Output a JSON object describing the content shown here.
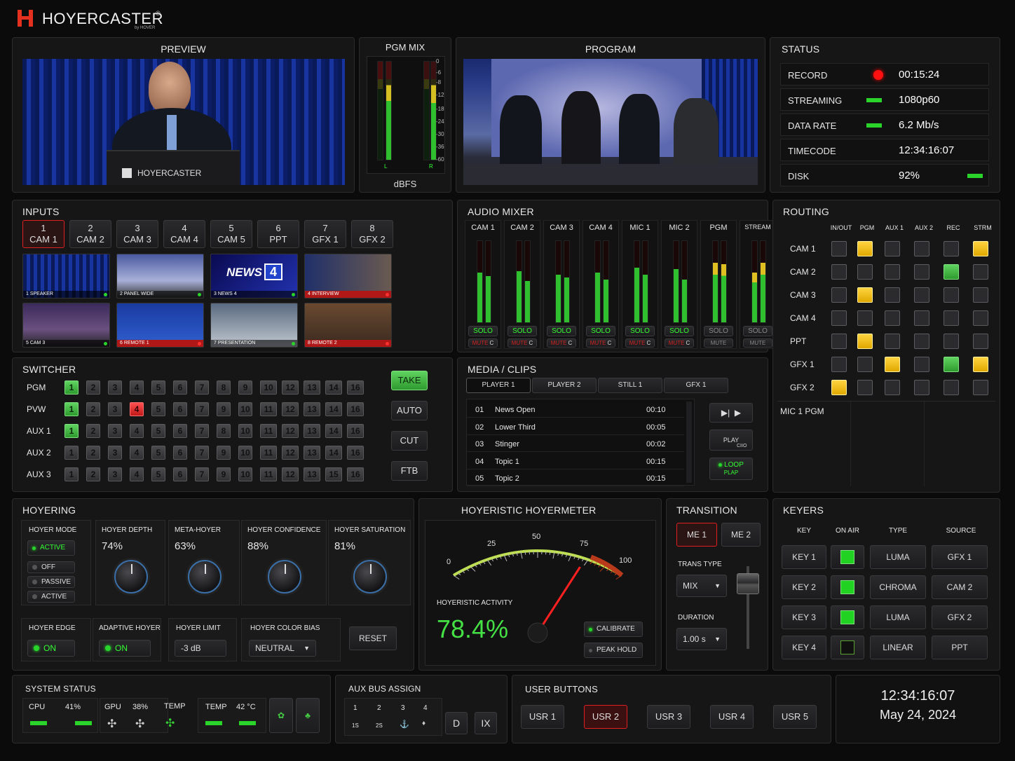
{
  "brand": {
    "name": "HOYERCASTER",
    "reg": "®",
    "sub": "by HOVER"
  },
  "preview": {
    "title": "PREVIEW",
    "watermark": "HOYERCASTER"
  },
  "pgm_mix": {
    "title": "PGM MIX",
    "unit": "dBFS",
    "scale": [
      "0",
      "-6",
      "-8",
      "-12",
      "-18",
      "-24",
      "-30",
      "-36",
      "-60"
    ],
    "l": "L",
    "r": "R"
  },
  "program": {
    "title": "PROGRAM"
  },
  "status": {
    "title": "STATUS",
    "rows": [
      {
        "label": "RECORD",
        "value": "00:15:24"
      },
      {
        "label": "STREAMING",
        "value": "1080p60"
      },
      {
        "label": "DATA RATE",
        "value": "6.2 Mb/s"
      },
      {
        "label": "TIMECODE",
        "value": "12:34:16:07"
      },
      {
        "label": "DISK",
        "value": "92%"
      }
    ]
  },
  "inputs": {
    "title": "INPUTS",
    "buttons": [
      {
        "num": "1",
        "name": "CAM 1"
      },
      {
        "num": "2",
        "name": "CAM 2"
      },
      {
        "num": "3",
        "name": "CAM 3"
      },
      {
        "num": "4",
        "name": "CAM 4"
      },
      {
        "num": "5",
        "name": "CAM 5"
      },
      {
        "num": "6",
        "name": "PPT"
      },
      {
        "num": "7",
        "name": "GFX 1"
      },
      {
        "num": "8",
        "name": "GFX 2"
      }
    ],
    "thumbs": [
      {
        "label": "1  SPEAKER"
      },
      {
        "label": "2  PANEL WIDE"
      },
      {
        "label": "3  NEWS 4"
      },
      {
        "label": "4  INTERVIEW"
      },
      {
        "label": "5  CAM 3"
      },
      {
        "label": "6  REMOTE 1"
      },
      {
        "label": "7  PRESENTATION"
      },
      {
        "label": "8  REMOTE 2"
      }
    ],
    "news_logo": "NEWS",
    "news_num": "4"
  },
  "audio": {
    "title": "AUDIO MIXER",
    "channels": [
      "CAM 1",
      "CAM 2",
      "CAM 3",
      "CAM 4",
      "MIC 1",
      "MIC 2",
      "PGM",
      "STREAM"
    ],
    "solo": "SOLO",
    "mute": "MUTE",
    "mute_flag": "C"
  },
  "routing": {
    "title": "ROUTING",
    "cols": [
      "IN/OUT",
      "PGM",
      "AUX 1",
      "AUX 2",
      "REC",
      "STRM"
    ],
    "rows": [
      "CAM 1",
      "CAM 2",
      "CAM 3",
      "CAM 4",
      "PPT",
      "GFX 1",
      "GFX 2"
    ],
    "extra": "MIC 1 PGM"
  },
  "switcher": {
    "title": "SWITCHER",
    "rows": [
      {
        "label": "PGM",
        "keys": [
          "1",
          "2",
          "3",
          "4",
          "5",
          "6",
          "7",
          "8",
          "9",
          "10",
          "12",
          "13",
          "14",
          "16"
        ]
      },
      {
        "label": "PVW",
        "keys": [
          "1",
          "2",
          "3",
          "4",
          "5",
          "6",
          "7",
          "9",
          "10",
          "11",
          "12",
          "13",
          "14",
          "16"
        ]
      },
      {
        "label": "AUX 1",
        "keys": [
          "1",
          "2",
          "3",
          "4",
          "5",
          "6",
          "7",
          "8",
          "10",
          "11",
          "12",
          "13",
          "14",
          "16"
        ]
      },
      {
        "label": "AUX 2",
        "keys": [
          "1",
          "2",
          "3",
          "4",
          "5",
          "6",
          "7",
          "9",
          "10",
          "11",
          "12",
          "13",
          "14",
          "16"
        ]
      },
      {
        "label": "AUX 3",
        "keys": [
          "1",
          "2",
          "3",
          "4",
          "5",
          "6",
          "7",
          "9",
          "10",
          "11",
          "12",
          "13",
          "15",
          "16"
        ]
      }
    ],
    "take": "TAKE",
    "auto": "AUTO",
    "cut": "CUT",
    "ftb": "FTB"
  },
  "media": {
    "title": "MEDIA / CLIPS",
    "tabs": [
      "PLAYER 1",
      "PLAYER 2",
      "STILL 1",
      "GFX 1"
    ],
    "clips": [
      {
        "n": "01",
        "name": "News Open",
        "dur": "00:10"
      },
      {
        "n": "02",
        "name": "Lower Third",
        "dur": "00:05"
      },
      {
        "n": "03",
        "name": "Stinger",
        "dur": "00:02"
      },
      {
        "n": "04",
        "name": "Topic 1",
        "dur": "00:15"
      },
      {
        "n": "05",
        "name": "Topic 2",
        "dur": "00:15"
      }
    ],
    "play": "PLAY",
    "cue": "CIIO",
    "loop": "LOOP",
    "loop2": "PLAP"
  },
  "hoyering": {
    "title": "HOYERING",
    "mode_label": "HOYER MODE",
    "modes": [
      "ACTIVE",
      "OFF",
      "PASSIVE",
      "ACTIVE"
    ],
    "knobs": [
      {
        "label": "HOYER DEPTH",
        "value": "74%"
      },
      {
        "label": "META-HOYER",
        "value": "63%"
      },
      {
        "label": "HOYER CONFIDENCE",
        "value": "88%"
      },
      {
        "label": "HOYER SATURATION",
        "value": "81%"
      }
    ],
    "edge_label": "HOYER EDGE",
    "edge_val": "ON",
    "adaptive_label": "ADAPTIVE HOYER",
    "adaptive_val": "ON",
    "limit_label": "HOYER LIMIT",
    "limit_val": "-3 dB",
    "bias_label": "HOYER COLOR BIAS",
    "bias_val": "NEUTRAL",
    "reset": "RESET"
  },
  "hoyermeter": {
    "title": "HOYERISTIC HOYERMETER",
    "ticks": [
      "0",
      "25",
      "50",
      "75",
      "100"
    ],
    "activity_label": "HOYERISTIC ACTIVITY",
    "activity": "78.4%",
    "value": 78.4,
    "calibrate": "CALIBRATE",
    "peak": "PEAK HOLD"
  },
  "transition": {
    "title": "TRANSITION",
    "me1": "ME 1",
    "me2": "ME 2",
    "type_label": "TRANS TYPE",
    "type_val": "MIX",
    "dur_label": "DURATION",
    "dur_val": "1.00 s"
  },
  "keyers": {
    "title": "KEYERS",
    "cols": [
      "KEY",
      "ON AIR",
      "TYPE",
      "SOURCE"
    ],
    "rows": [
      {
        "key": "KEY 1",
        "type": "LUMA",
        "source": "GFX 1"
      },
      {
        "key": "KEY 2",
        "type": "CHROMA",
        "source": "CAM 2"
      },
      {
        "key": "KEY 3",
        "type": "LUMA",
        "source": "GFX 2"
      },
      {
        "key": "KEY 4",
        "type": "LINEAR",
        "source": "PPT"
      }
    ]
  },
  "system": {
    "title": "SYSTEM STATUS",
    "cpu": "CPU",
    "cpu_val": "41%",
    "gpu": "GPU",
    "gpu_val": "38%",
    "temp": "TEMP",
    "temp2": "TEMP",
    "temp2_val": "42 °C"
  },
  "auxbus": {
    "title": "AUX BUS ASSIGN",
    "nums": [
      "1",
      "2",
      "3",
      "4"
    ],
    "subs": [
      "1S",
      "2S",
      "",
      ""
    ],
    "d": "D",
    "ix": "IX"
  },
  "user": {
    "title": "USER BUTTONS",
    "buttons": [
      "USR 1",
      "USR 2",
      "USR 3",
      "USR 4",
      "USR 5"
    ]
  },
  "clock": {
    "time": "12:34:16:07",
    "date": "May 24, 2024"
  }
}
